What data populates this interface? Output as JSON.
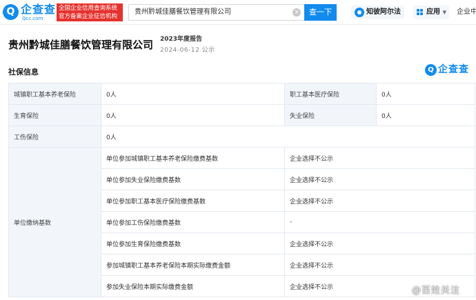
{
  "header": {
    "logo_text": "企查查",
    "logo_sub": "Qcc.com",
    "tagline_line1": "全国企业信用查询系统",
    "tagline_line2": "官方备案企业征信机构",
    "search_value": "贵州黔城佳膳餐饮管理有限公司",
    "search_button": "查一下",
    "zhiche_label": "知彼阿尔法",
    "apps_label": "应用",
    "center_label": "企业中"
  },
  "company": {
    "name": "贵州黔城佳膳餐饮管理有限公司",
    "report_year": "2023年度报告",
    "report_date": "2024-06-12 公示"
  },
  "section": {
    "title": "社保信息",
    "watermark": "企查查"
  },
  "table": {
    "row1": {
      "l1": "城镇职工基本养老保险",
      "v1": "0人",
      "l2": "职工基本医疗保险",
      "v2": "0人"
    },
    "row2": {
      "l1": "生育保险",
      "v1": "0人",
      "l2": "失业保险",
      "v2": "0人"
    },
    "row3": {
      "l1": "工伤保险",
      "v1": "0人"
    },
    "payment_label": "单位缴纳基数",
    "payments": [
      {
        "item": "单位参加城镇职工基本养老保险缴费基数",
        "value": "企业选择不公示"
      },
      {
        "item": "单位参加失业保险缴费基数",
        "value": "企业选择不公示"
      },
      {
        "item": "单位参加职工基本医疗保险缴费基数",
        "value": "企业选择不公示"
      },
      {
        "item": "单位参加工伤保险缴费基数",
        "value": "-"
      },
      {
        "item": "单位参加生育保险缴费基数",
        "value": "企业选择不公示"
      },
      {
        "item": "参加城镇职工基本养老保险本期实际缴费金额",
        "value": "企业选择不公示"
      },
      {
        "item": "参加失业保险本期实际缴费金额",
        "value": "企业选择不公示"
      }
    ]
  },
  "watermark_weibo": "@百姓关注"
}
